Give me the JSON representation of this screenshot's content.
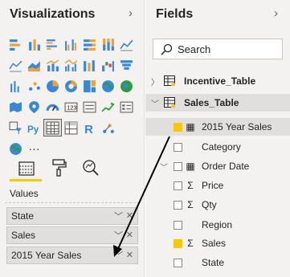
{
  "visualizations": {
    "title": "Visualizations",
    "collapse": "›",
    "values_label": "Values",
    "wells": [
      {
        "label": "State"
      },
      {
        "label": "Sales"
      },
      {
        "label": "2015 Year Sales"
      }
    ],
    "more": "···"
  },
  "fields": {
    "title": "Fields",
    "collapse": "›",
    "search_placeholder": "Search",
    "tables": [
      {
        "name": "Incentive_Table",
        "expanded": false
      },
      {
        "name": "Sales_Table",
        "expanded": true
      }
    ],
    "items": [
      {
        "label": "2015 Year Sales",
        "checked": true,
        "icon": "calculator-icon"
      },
      {
        "label": "Category",
        "checked": false,
        "icon": ""
      },
      {
        "label": "Order Date",
        "checked": false,
        "icon": "calendar-icon"
      },
      {
        "label": "Price",
        "checked": false,
        "icon": "sigma-icon"
      },
      {
        "label": "Qty",
        "checked": false,
        "icon": "sigma-icon"
      },
      {
        "label": "Region",
        "checked": false,
        "icon": ""
      },
      {
        "label": "Sales",
        "checked": true,
        "icon": "sigma-icon"
      },
      {
        "label": "State",
        "checked": false,
        "icon": ""
      }
    ]
  },
  "colors": {
    "accent": "#f2c811",
    "pane_bg": "#f3f2f1"
  }
}
